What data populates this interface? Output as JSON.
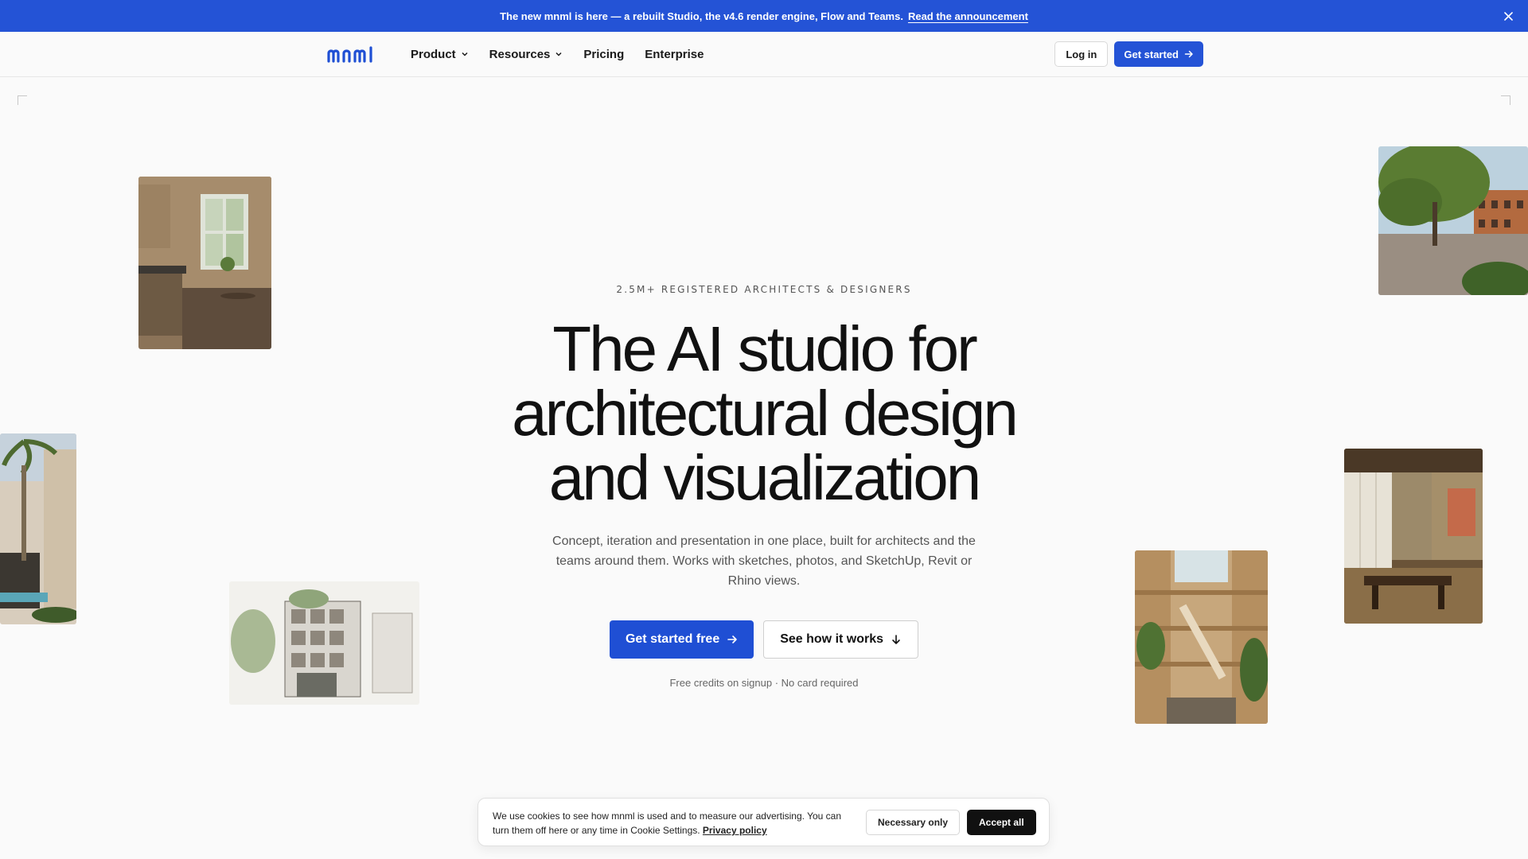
{
  "announcement": {
    "text": "The new mnml is here — a rebuilt Studio, the v4.6 render engine, Flow and Teams.",
    "link": "Read the announcement"
  },
  "nav": {
    "logo": "mnml",
    "items": [
      {
        "label": "Product",
        "has_dropdown": true
      },
      {
        "label": "Resources",
        "has_dropdown": true
      },
      {
        "label": "Pricing",
        "has_dropdown": false
      },
      {
        "label": "Enterprise",
        "has_dropdown": false
      }
    ],
    "login": "Log in",
    "get_started": "Get started"
  },
  "hero": {
    "eyebrow": "2.5M+ REGISTERED ARCHITECTS & DESIGNERS",
    "headline_line1": "The AI studio for",
    "headline_line2": "architectural design",
    "headline_line3": "and visualization",
    "subtext": "Concept, iteration and presentation in one place, built for architects and the teams around them. Works with sketches, photos, and SketchUp, Revit or Rhino views.",
    "cta_primary": "Get started free",
    "cta_secondary": "See how it works",
    "note": "Free credits on signup · No card required"
  },
  "cookie": {
    "text": "We use cookies to see how mnml is used and to measure our advertising. You can turn them off here or any time in Cookie Settings.",
    "privacy": "Privacy policy",
    "necessary": "Necessary only",
    "accept": "Accept all"
  },
  "colors": {
    "accent": "#2453d6",
    "background": "#fafafa",
    "text": "#111111"
  },
  "icons": [
    "close-icon",
    "chevron-down-icon",
    "arrow-right-icon",
    "arrow-down-icon"
  ]
}
